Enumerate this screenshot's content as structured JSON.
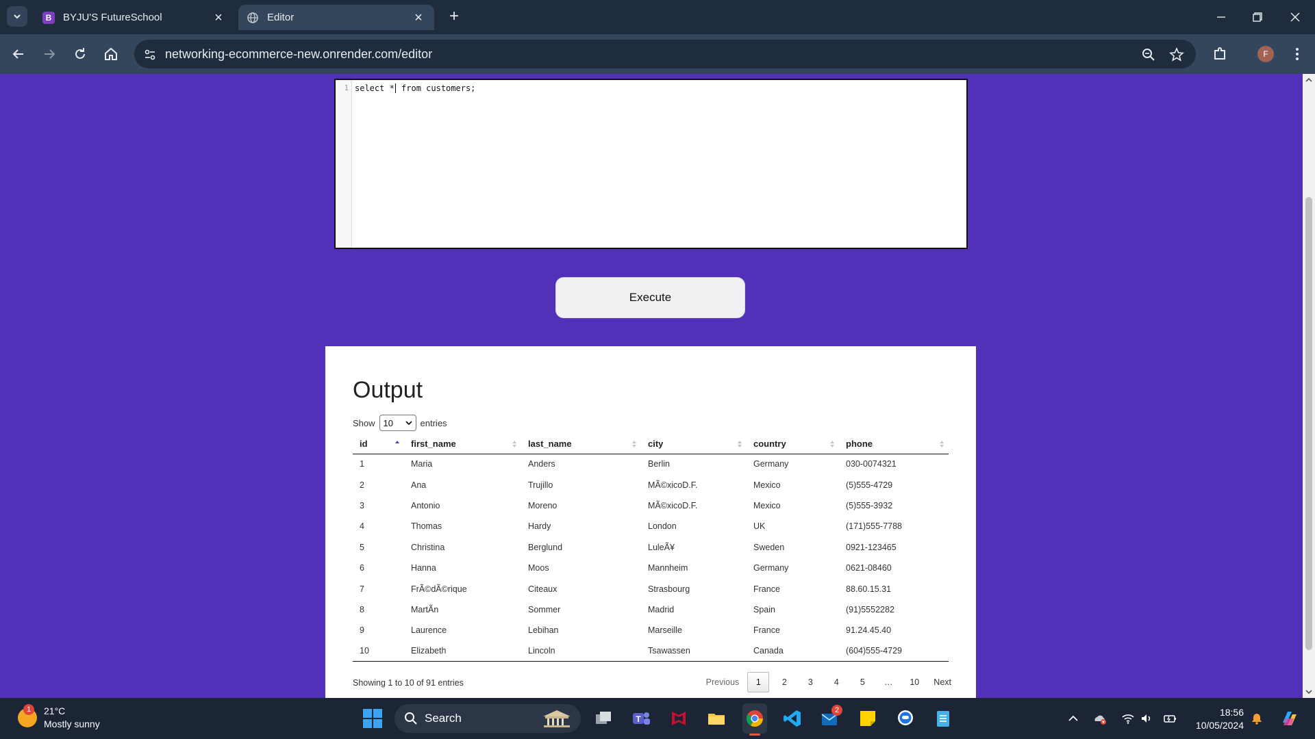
{
  "browser": {
    "tabs": [
      {
        "title": "BYJU'S FutureSchool",
        "active": false
      },
      {
        "title": "Editor",
        "active": true
      }
    ],
    "url": "networking-ecommerce-new.onrender.com/editor",
    "profile_initial": "F"
  },
  "editor": {
    "line_number": "1",
    "code_before_cursor": "select *",
    "code_after_cursor": " from customers;"
  },
  "execute_label": "Execute",
  "output": {
    "title": "Output",
    "show_label": "Show",
    "entries_label": "entries",
    "page_length": "10",
    "columns": [
      "id",
      "first_name",
      "last_name",
      "city",
      "country",
      "phone"
    ],
    "sorted_column": "id",
    "rows": [
      [
        "1",
        "Maria",
        "Anders",
        "Berlin",
        "Germany",
        "030-0074321"
      ],
      [
        "2",
        "Ana",
        "Trujillo",
        "MÃ©xicoD.F.",
        "Mexico",
        "(5)555-4729"
      ],
      [
        "3",
        "Antonio",
        "Moreno",
        "MÃ©xicoD.F.",
        "Mexico",
        "(5)555-3932"
      ],
      [
        "4",
        "Thomas",
        "Hardy",
        "London",
        "UK",
        "(171)555-7788"
      ],
      [
        "5",
        "Christina",
        "Berglund",
        "LuleÃ¥",
        "Sweden",
        "0921-123465"
      ],
      [
        "6",
        "Hanna",
        "Moos",
        "Mannheim",
        "Germany",
        "0621-08460"
      ],
      [
        "7",
        "FrÃ©dÃ©rique",
        "Citeaux",
        "Strasbourg",
        "France",
        "88.60.15.31"
      ],
      [
        "8",
        "MartÃn",
        "Sommer",
        "Madrid",
        "Spain",
        "(91)5552282"
      ],
      [
        "9",
        "Laurence",
        "Lebihan",
        "Marseille",
        "France",
        "91.24.45.40"
      ],
      [
        "10",
        "Elizabeth",
        "Lincoln",
        "Tsawassen",
        "Canada",
        "(604)555-4729"
      ]
    ],
    "info": "Showing 1 to 10 of 91 entries",
    "pagination": {
      "previous": "Previous",
      "pages": [
        "1",
        "2",
        "3",
        "4",
        "5",
        "…",
        "10"
      ],
      "current": "1",
      "next": "Next"
    }
  },
  "taskbar": {
    "weather_temp": "21°C",
    "weather_desc": "Mostly sunny",
    "weather_badge": "1",
    "search_label": "Search",
    "mail_badge": "2",
    "time": "18:56",
    "date": "10/05/2024"
  },
  "colors": {
    "page_background": "#5131b8",
    "browser_frame": "#1f2c3d",
    "toolbar": "#34465c",
    "taskbar": "#1b2535"
  }
}
